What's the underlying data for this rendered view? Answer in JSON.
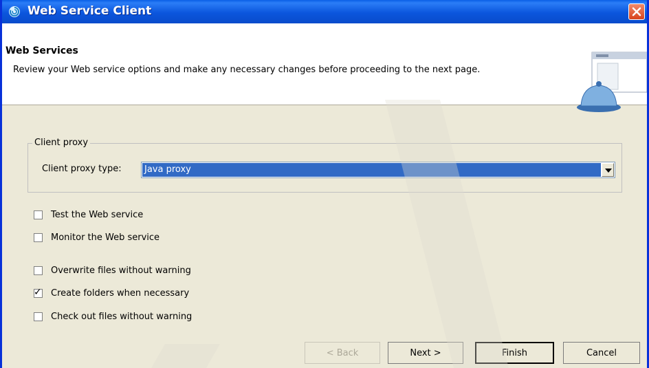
{
  "window": {
    "title": "Web Service Client"
  },
  "header": {
    "title": "Web Services",
    "description": "Review your Web service options and make any necessary changes before proceeding to the next page."
  },
  "client_proxy": {
    "group_label": "Client proxy",
    "type_label": "Client proxy type:",
    "type_value": "Java proxy"
  },
  "options": [
    {
      "label": "Test the Web service",
      "checked": false
    },
    {
      "label": "Monitor the Web service",
      "checked": false
    },
    {
      "label": "Overwrite files without warning",
      "checked": false
    },
    {
      "label": "Create folders when necessary",
      "checked": true
    },
    {
      "label": "Check out files without warning",
      "checked": false
    }
  ],
  "buttons": {
    "back": "< Back",
    "next": "Next >",
    "finish": "Finish",
    "cancel": "Cancel"
  },
  "colors": {
    "title_bar": "#0b56dd",
    "selection": "#316ac5",
    "dialog_bg": "#ece9d8"
  },
  "icons": {
    "app": "web-service-icon",
    "close": "close-icon",
    "banner": "web-service-banner-icon"
  }
}
